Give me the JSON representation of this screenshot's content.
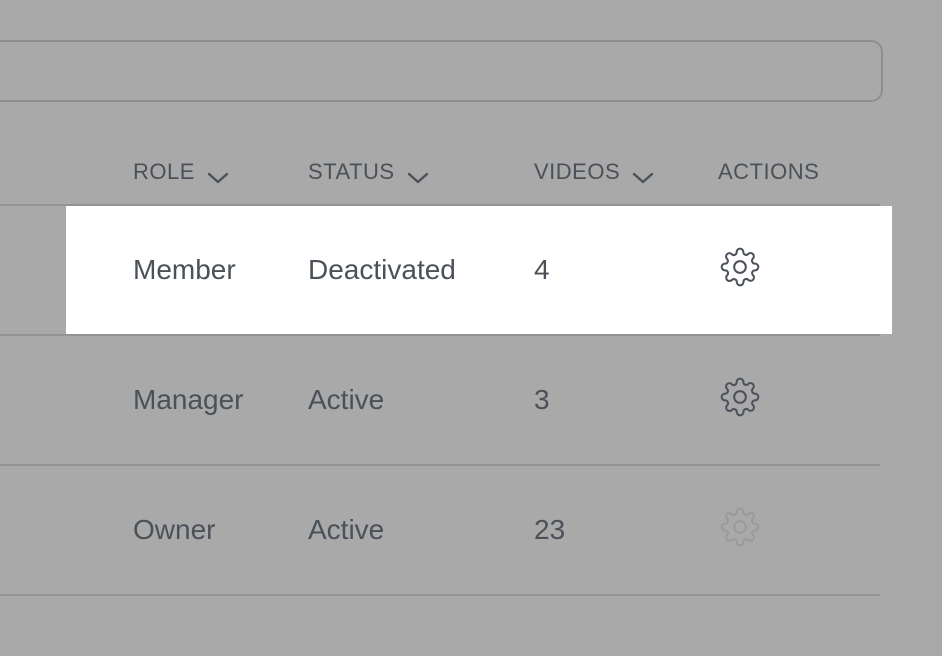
{
  "table": {
    "headers": {
      "role": "ROLE",
      "status": "STATUS",
      "videos": "VIDEOS",
      "actions": "ACTIONS"
    },
    "rows": [
      {
        "role": "Member",
        "status": "Deactivated",
        "videos": "4",
        "settings_icon": "gear-icon",
        "highlighted": true,
        "settings_enabled": true
      },
      {
        "role": "Manager",
        "status": "Active",
        "videos": "3",
        "settings_icon": "gear-icon",
        "highlighted": false,
        "settings_enabled": true
      },
      {
        "role": "Owner",
        "status": "Active",
        "videos": "23",
        "settings_icon": "gear-icon",
        "highlighted": false,
        "settings_enabled": false
      }
    ]
  },
  "colors": {
    "overlay": "#a9a9a9",
    "highlight_row": "#ffffff",
    "text": "#4b5159",
    "gear_disabled": "#9a9a9a"
  }
}
